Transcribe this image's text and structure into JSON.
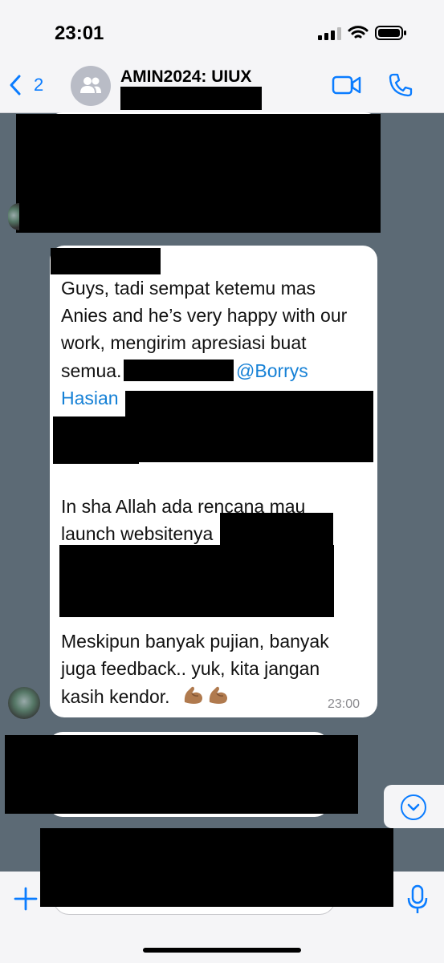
{
  "status_bar": {
    "time": "23:01"
  },
  "header": {
    "back_count": "2",
    "title": "AMIN2024: UIUX"
  },
  "message": {
    "lines": [
      "Guys, tadi sempat ketemu mas",
      "Anies and he’s very happy with our",
      "work, mengirim apresiasi buat",
      "semua."
    ],
    "mention_1": "@Borrys",
    "mention_2": "Hasian",
    "line_5": "In sha Allah ada rencana mau",
    "line_6": "launch websitenya",
    "line_7": "Meskipun banyak pujian, banyak",
    "line_8": "juga feedback.. yuk, kita jangan",
    "line_9": "kasih kendor.",
    "emoji": [
      "flexed-biceps",
      "flexed-biceps"
    ],
    "time": "23:00"
  },
  "colors": {
    "accent": "#0a7cff",
    "mention": "#1681d6",
    "chat_background": "#5c6a75",
    "bubble": "#ffffff"
  }
}
